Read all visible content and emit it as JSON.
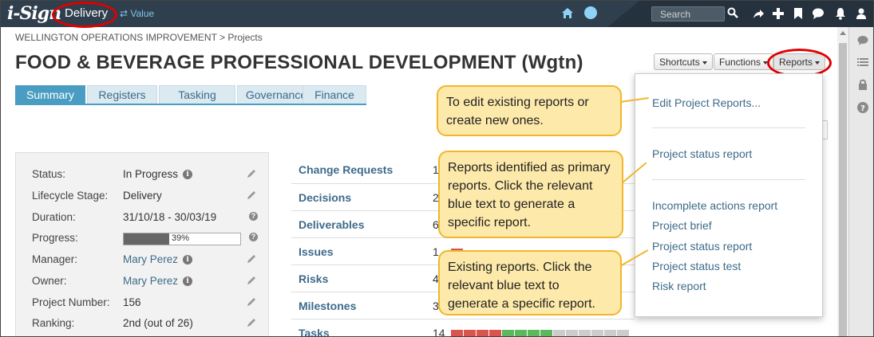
{
  "topbar": {
    "logo": "i-Sign",
    "mode": "Delivery",
    "switch_label": "⇄ Value",
    "search_placeholder": "Search"
  },
  "breadcrumb": "WELLINGTON OPERATIONS IMPROVEMENT > Projects",
  "page_title": "FOOD & BEVERAGE PROFESSIONAL DEVELOPMENT (Wgtn)",
  "buttons": {
    "shortcuts": "Shortcuts",
    "functions": "Functions",
    "reports": "Reports"
  },
  "tabs": [
    {
      "label": "Summary"
    },
    {
      "label": "Registers"
    },
    {
      "label": "Tasking"
    },
    {
      "label": "Governance"
    },
    {
      "label": "Finance"
    }
  ],
  "info": [
    {
      "label": "Status:",
      "value": "In Progress"
    },
    {
      "label": "Lifecycle Stage:",
      "value": "Delivery"
    },
    {
      "label": "Duration:",
      "value": "31/10/18 - 30/03/19"
    },
    {
      "label": "Progress:",
      "value": "39%",
      "percent": 39
    },
    {
      "label": "Manager:",
      "value": "Mary Perez"
    },
    {
      "label": "Owner:",
      "value": "Mary Perez"
    },
    {
      "label": "Project Number:",
      "value": "156"
    },
    {
      "label": "Ranking:",
      "value": "2nd (out of 26)"
    }
  ],
  "registers": [
    {
      "name": "Change Requests",
      "count": "1"
    },
    {
      "name": "Decisions",
      "count": "2"
    },
    {
      "name": "Deliverables",
      "count": "6"
    },
    {
      "name": "Issues",
      "count": "1"
    },
    {
      "name": "Risks",
      "count": "4"
    },
    {
      "name": "Milestones",
      "count": "3"
    },
    {
      "name": "Tasks",
      "count": "14"
    }
  ],
  "tasks_bar_colors": [
    "#d9534f",
    "#d9534f",
    "#d9534f",
    "#d9534f",
    "#5cb85c",
    "#5cb85c",
    "#5cb85c",
    "#5cb85c",
    "#cccccc",
    "#cccccc",
    "#cccccc",
    "#cccccc",
    "#cccccc",
    "#cccccc"
  ],
  "dropdown": {
    "edit": "Edit Project Reports...",
    "primary": [
      "Project status report"
    ],
    "existing": [
      "Incomplete actions report",
      "Project brief",
      "Project status report",
      "Project status test",
      "Risk report"
    ]
  },
  "callouts": {
    "edit": "To edit existing reports or create new ones.",
    "primary": "Reports identified as primary reports. Click the relevant blue text to generate a specific report.",
    "existing": "Existing reports. Click the relevant blue text to generate a specific report."
  },
  "colors": {
    "accent": "#4a9dc2",
    "link": "#3d6b8a",
    "topbar": "#2f3f4d",
    "callout": "#fde9a9",
    "highlight_ring": "#e00000"
  }
}
